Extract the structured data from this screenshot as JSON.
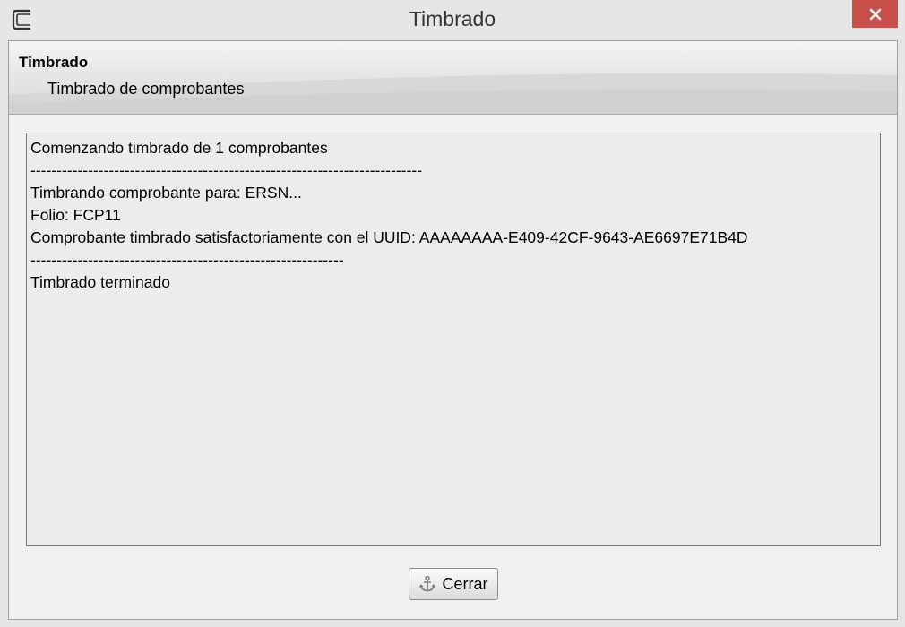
{
  "window": {
    "title": "Timbrado",
    "close_glyph": "✕",
    "close_color": "#c7504c"
  },
  "header": {
    "title": "Timbrado",
    "subtitle": "Timbrado de comprobantes"
  },
  "log": {
    "lines": [
      "Comenzando timbrado de 1 comprobantes",
      "---------------------------------------------------------------------------",
      "Timbrando comprobante para: ERSN...",
      "Folio: FCP11",
      "Comprobante timbrado satisfactoriamente con el UUID: AAAAAAAA-E409-42CF-9643-AE6697E71B4D",
      "------------------------------------------------------------",
      "Timbrado terminado"
    ]
  },
  "footer": {
    "close_button_label": "Cerrar",
    "close_button_icon": "anchor-icon"
  }
}
